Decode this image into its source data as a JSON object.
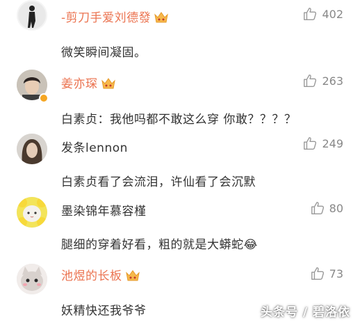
{
  "comments": [
    {
      "username": "-剪刀手爱刘德發",
      "name_color": "orange",
      "crown": true,
      "verified": false,
      "likes": "402",
      "text": "微笑瞬间凝固。",
      "avatar": "silhouette"
    },
    {
      "username": "姜亦琛",
      "name_color": "orange",
      "crown": true,
      "verified": true,
      "likes": "263",
      "text": "白素贞：我他吗都不敢这么穿  你敢？？？？",
      "avatar": "young-man"
    },
    {
      "username": "发条lennon",
      "name_color": "dark",
      "crown": false,
      "verified": false,
      "likes": "249",
      "text": "白素贞看了会流泪，许仙看了会沉默",
      "avatar": "long-hair"
    },
    {
      "username": "墨染锦年慕容槿",
      "name_color": "dark",
      "crown": false,
      "verified": false,
      "likes": "80",
      "text": "腿细的穿着好看，粗的就是大蟒蛇😂",
      "avatar": "cat-flower"
    },
    {
      "username": "池煜的长板",
      "name_color": "orange",
      "crown": true,
      "verified": false,
      "likes": "73",
      "text": "妖精快还我爷爷",
      "avatar": "cute-cat"
    }
  ],
  "watermark": "头条号 / 碧洛依",
  "colors": {
    "vip_name": "#eb7350",
    "text": "#333333",
    "like": "#888888",
    "crown": "#f7b84b"
  }
}
